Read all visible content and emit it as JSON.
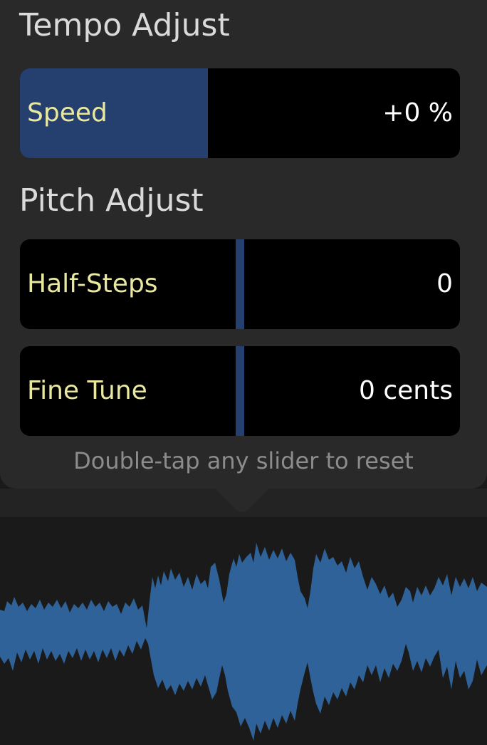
{
  "tempo": {
    "title": "Tempo Adjust",
    "speed": {
      "label": "Speed",
      "value": "+0 %",
      "level": 0.43
    }
  },
  "pitch": {
    "title": "Pitch Adjust",
    "half_steps": {
      "label": "Half-Steps",
      "value": "0",
      "level": 0.5
    },
    "fine_tune": {
      "label": "Fine Tune",
      "value": "0 cents",
      "level": 0.5
    }
  },
  "hint": "Double-tap any slider to reset",
  "colors": {
    "panel_bg": "#292929",
    "slider_bg": "#000000",
    "slider_fill": "#25406f",
    "label_color": "#e9e8a0",
    "waveform": "#2f6299"
  }
}
